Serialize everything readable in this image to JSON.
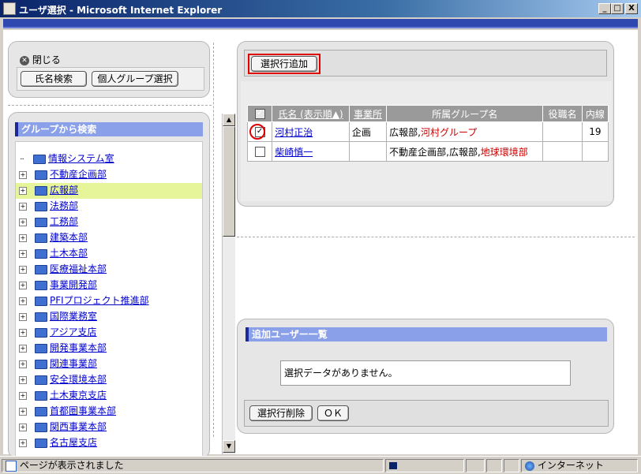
{
  "window": {
    "title": "ユーザ選択 - Microsoft Internet Explorer",
    "minimize": "_",
    "maximize": "□",
    "close": "X"
  },
  "left": {
    "close_label": "閉じる",
    "name_search_button": "氏名検索",
    "personal_group_button": "個人グループ選択",
    "group_search_header": "グループから検索",
    "tree_items": [
      "情報システム室",
      "不動産企画部",
      "広報部",
      "法務部",
      "工務部",
      "建築本部",
      "土木本部",
      "医療福祉本部",
      "事業開発部",
      "PFIプロジェクト推進部",
      "国際業務室",
      "アジア支店",
      "開発事業本部",
      "関連事業部",
      "安全環境本部",
      "土木東京支店",
      "首都圏事業本部",
      "関西事業本部",
      "名古屋支店"
    ],
    "selected_index": 2
  },
  "right": {
    "add_selected_button": "選択行追加",
    "table": {
      "headers": [
        "氏名 (表示順▲)",
        "事業所",
        "所属グループ名",
        "役職名",
        "内線"
      ],
      "rows": [
        {
          "checked": true,
          "name": "河村正治",
          "office": "企画",
          "groups_prefix": "広報部,",
          "groups_highlight": "河村グループ",
          "title": "",
          "ext": "19"
        },
        {
          "checked": false,
          "name": "柴崎慎一",
          "office": "",
          "groups_prefix": "不動産企画部,広報部,",
          "groups_highlight": "地球環境部",
          "title": "",
          "ext": ""
        }
      ]
    },
    "added_users_header": "追加ユーザー一覧",
    "no_data_message": "選択データがありません。",
    "delete_selected_button": "選択行削除",
    "ok_button": "ＯＫ"
  },
  "status": {
    "message": "ページが表示されました",
    "zone": "インターネット"
  },
  "colors": {
    "titlebar": "#0a246a",
    "highlight_red": "#cc0000",
    "link": "#0000cc",
    "selected_row": "#e6f59a"
  }
}
